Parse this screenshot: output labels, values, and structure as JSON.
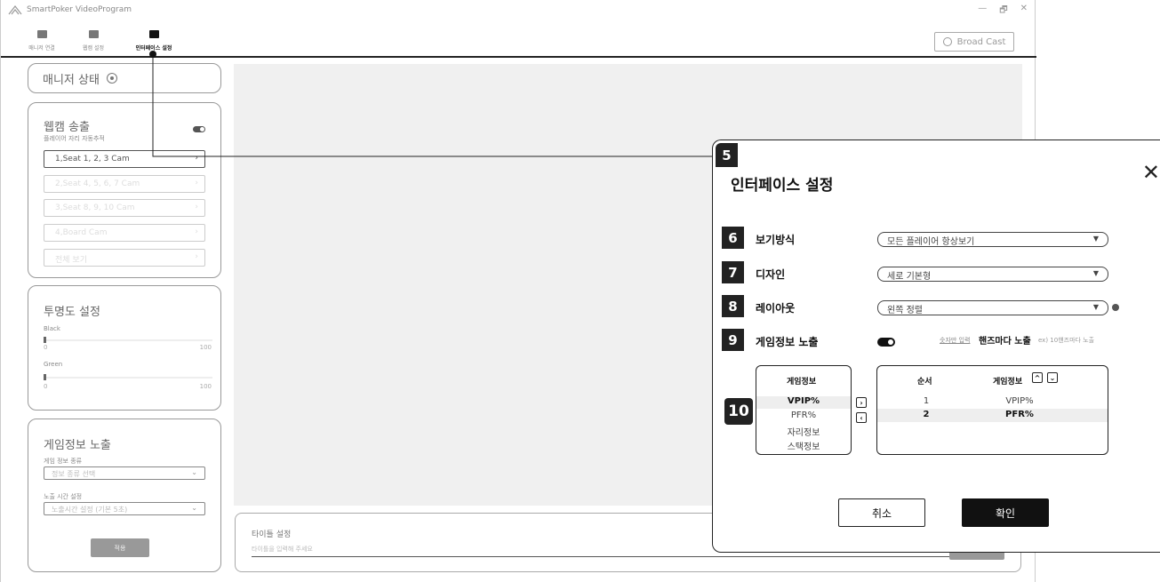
{
  "window": {
    "title": "SmartPoker VideoProgram",
    "controls": [
      "—",
      "🗗",
      "✕"
    ]
  },
  "toolbar": {
    "tabs": [
      {
        "label": "매니저 연결"
      },
      {
        "label": "웹캠 설정"
      },
      {
        "label": "인터페이스 설정"
      }
    ],
    "broadcast_label": "Broad Cast"
  },
  "sidebar": {
    "manager": {
      "label": "매니저 상태"
    },
    "webcam": {
      "title": "웹캠 송출",
      "subtitle": "플레이어 자리 자동추적",
      "cams": [
        {
          "label": "1,Seat 1, 2, 3 Cam"
        },
        {
          "label": "2,Seat 4, 5, 6, 7 Cam"
        },
        {
          "label": "3,Seat 8, 9, 10 Cam"
        },
        {
          "label": "4,Board Cam"
        },
        {
          "label": "전체 보기"
        }
      ],
      "arrow": "›"
    },
    "opacity": {
      "title": "투명도 설정",
      "black_label": "Black",
      "green_label": "Green",
      "min": "0",
      "max": "100"
    },
    "gameinfo": {
      "title": "게임정보 노출",
      "type_label": "게임 정보 종류",
      "type_placeholder": "정보 종류 선택",
      "time_label": "노출 시간 설정",
      "time_placeholder": "노출시간 설정 (기본 5초)",
      "apply_label": "적용",
      "arrow": "⌄"
    }
  },
  "title_panel": {
    "label": "타이틀 설정",
    "placeholder": "타이틀을 입력해 주세요"
  },
  "modal": {
    "badge": "5",
    "title": "인터페이스 설정",
    "close": "✕",
    "rows": [
      {
        "badge": "6",
        "label": "보기방식",
        "value": "모든 플레이어 항상보기"
      },
      {
        "badge": "7",
        "label": "디자인",
        "value": "세로 기본형"
      },
      {
        "badge": "8",
        "label": "레이아웃",
        "value": "왼쪽 정렬"
      },
      {
        "badge": "9",
        "label": "게임정보 노출"
      }
    ],
    "select_arrow": "▼",
    "num_input_link": "숫자만 입력",
    "hand_label": "핸즈마다 노출",
    "example": "ex) 10핸즈마다 노출",
    "list_badge": "10",
    "left_header": "게임정보",
    "left_items": [
      "VPIP%",
      "PFR%",
      "자리정보",
      "스택정보"
    ],
    "right_order_header": "순서",
    "right_info_header": "게임정보",
    "right_rows": [
      {
        "order": "1",
        "info": "VPIP%"
      },
      {
        "order": "2",
        "info": "PFR%"
      }
    ],
    "move_right": "›",
    "move_left": "‹",
    "up": "^",
    "down": "⌄",
    "cancel_label": "취소",
    "ok_label": "확인"
  }
}
